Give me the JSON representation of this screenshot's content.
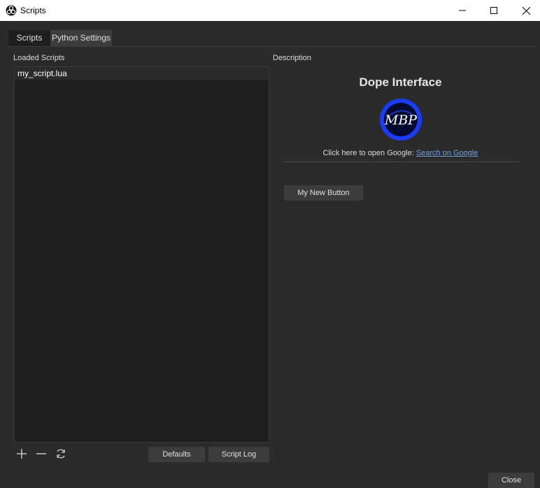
{
  "window": {
    "title": "Scripts",
    "controls": [
      "minimize-icon",
      "maximize-icon",
      "close-icon"
    ]
  },
  "tabs": [
    {
      "label": "Scripts",
      "active": true
    },
    {
      "label": "Python Settings",
      "active": false
    }
  ],
  "left_panel": {
    "label": "Loaded Scripts",
    "scripts": [
      "my_script.lua"
    ],
    "icon_buttons": [
      "plus-icon",
      "minus-icon",
      "refresh-icon"
    ],
    "defaults_label": "Defaults",
    "script_log_label": "Script Log"
  },
  "right_panel": {
    "label": "Description",
    "title": "Dope Interface",
    "logo_text": "MBP",
    "google_prefix": "Click here to open Google: ",
    "google_link": "Search on Google",
    "new_button_label": "My New Button"
  },
  "footer": {
    "close_label": "Close"
  },
  "colors": {
    "background": "#2b2b2b",
    "list_background": "#1f1f1f",
    "button": "#3c3c3c",
    "link": "#6ea0e6",
    "logo_blue": "#1a3cff"
  }
}
